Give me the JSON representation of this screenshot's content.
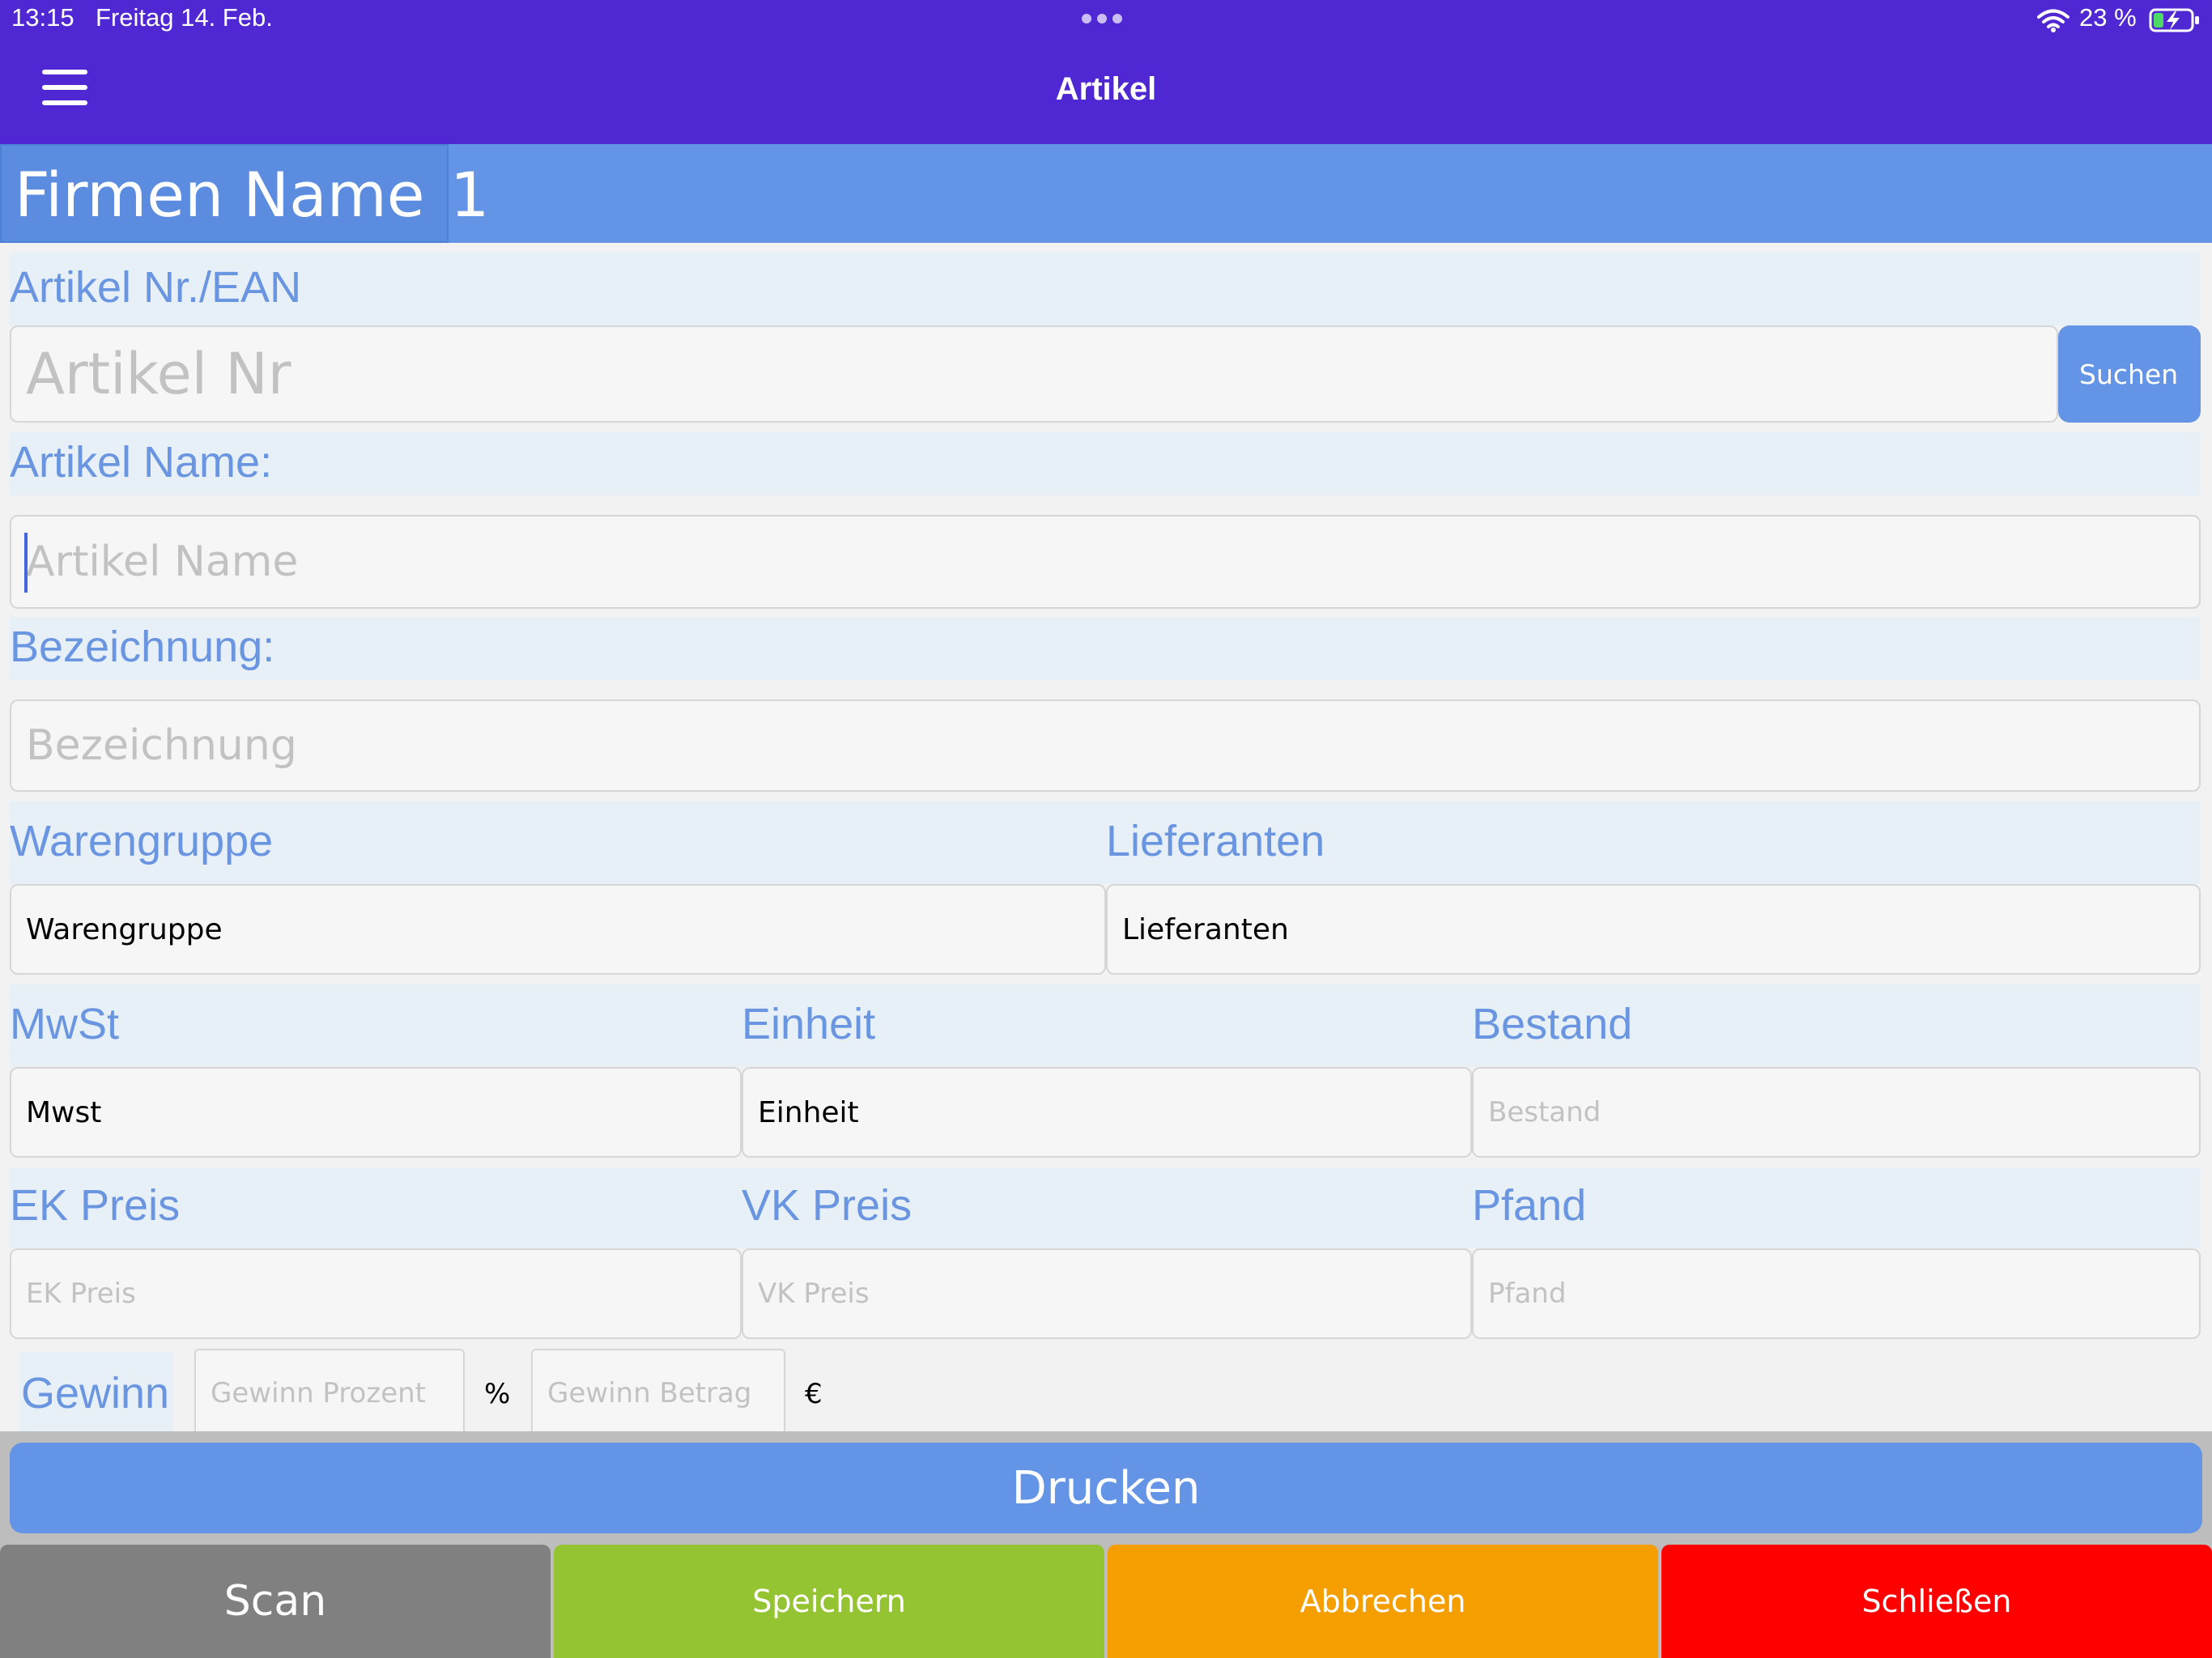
{
  "status_bar": {
    "time": "13:15",
    "date": "Freitag 14. Feb.",
    "battery": "23 %"
  },
  "nav": {
    "title": "Artikel",
    "menu_icon": "hamburger-menu-icon"
  },
  "company": {
    "name": "Firmen Name",
    "number": "1"
  },
  "form": {
    "article_no": {
      "label": "Artikel Nr./EAN",
      "placeholder": "Artikel Nr",
      "search_label": "Suchen"
    },
    "article_name": {
      "label": "Artikel Name:",
      "placeholder": "Artikel Name"
    },
    "designation": {
      "label": "Bezeichnung:",
      "placeholder": "Bezeichnung"
    },
    "product_group": {
      "label": "Warengruppe",
      "value": "Warengruppe"
    },
    "suppliers": {
      "label": "Lieferanten",
      "value": "Lieferanten"
    },
    "vat": {
      "label": "MwSt",
      "value": "Mwst"
    },
    "unit": {
      "label": "Einheit",
      "value": "Einheit"
    },
    "stock": {
      "label": "Bestand",
      "placeholder": "Bestand"
    },
    "purchase_price": {
      "label": "EK Preis",
      "placeholder": "EK Preis"
    },
    "sale_price": {
      "label": "VK Preis",
      "placeholder": "VK Preis"
    },
    "deposit": {
      "label": "Pfand",
      "placeholder": "Pfand"
    },
    "profit": {
      "label": "Gewinn",
      "percent_placeholder": "Gewinn Prozent",
      "percent_unit": "%",
      "amount_placeholder": "Gewinn Betrag",
      "amount_unit": "€"
    }
  },
  "buttons": {
    "print": "Drucken",
    "scan": "Scan",
    "save": "Speichern",
    "cancel": "Abbrechen",
    "close": "Schließen"
  },
  "colors": {
    "nav_bar": "#4f28d3",
    "accent_blue": "#6494e5",
    "scan": "#808080",
    "save": "#95c433",
    "cancel": "#f59e00",
    "close": "#fe0000"
  }
}
